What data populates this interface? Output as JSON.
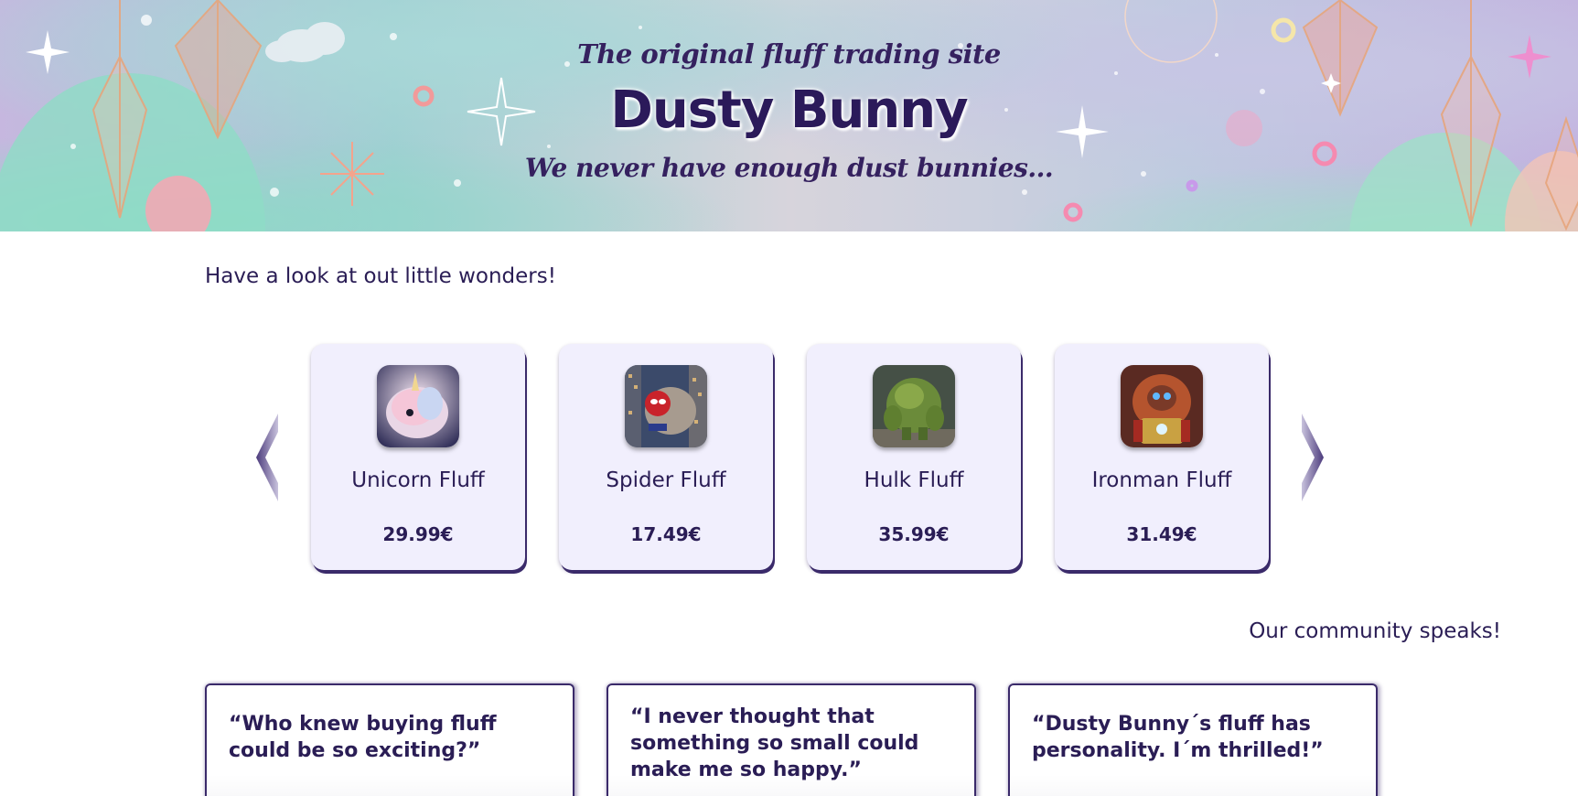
{
  "hero": {
    "tagline": "The original fluff trading site",
    "title": "Dusty Bunny",
    "subtitle": "We never have enough dust bunnies..."
  },
  "products_section": {
    "heading": "Have a look at out little wonders!",
    "prev_icon": "chevron-left-icon",
    "next_icon": "chevron-right-icon",
    "items": [
      {
        "name": "Unicorn Fluff",
        "price": "29.99€",
        "image": "unicorn-fluff-image"
      },
      {
        "name": "Spider Fluff",
        "price": "17.49€",
        "image": "spider-fluff-image"
      },
      {
        "name": "Hulk Fluff",
        "price": "35.99€",
        "image": "hulk-fluff-image"
      },
      {
        "name": "Ironman Fluff",
        "price": "31.49€",
        "image": "ironman-fluff-image"
      }
    ]
  },
  "community_section": {
    "heading": "Our community speaks!",
    "testimonials": [
      {
        "quote": "“Who knew buying fluff could be so exciting?”"
      },
      {
        "quote": "“I never thought that something so small could make me so happy.”"
      },
      {
        "quote": "“Dusty Bunny´s fluff has personality. I´m thrilled!”"
      }
    ]
  },
  "colors": {
    "text": "#2a1d55",
    "card_background": "#f1effd",
    "card_shadow": "#3a2a6a"
  }
}
